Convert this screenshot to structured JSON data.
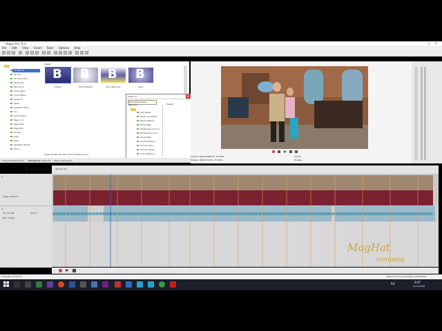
{
  "window": {
    "title": "Vegas Pro 15.0"
  },
  "menu": [
    "File",
    "Edit",
    "View",
    "Insert",
    "Tools",
    "Options",
    "Help"
  ],
  "explorer": {
    "items": [
      "3D Effects",
      "3D Flip",
      "3D Fly In/Out",
      "3D Blinds",
      "Barn Door",
      "Clock Wipe",
      "Cross Effect",
      "Dissolve",
      "Flash",
      "Gradient Wipe",
      "Iris",
      "Linear Wipe",
      "Page Curl",
      "Page Peel",
      "Page Roll",
      "Portals",
      "Push",
      "Split",
      "Venetian Blinds",
      "Zoom"
    ]
  },
  "presets": {
    "header": "Preset:",
    "thumbs": [
      {
        "label": "Simple"
      },
      {
        "label": "Soft Spotlight"
      },
      {
        "label": "Burn Rainbow"
      },
      {
        "label": "Spot"
      }
    ],
    "status": "Vegas 3D Blinds: OFX, 32-bit floating point"
  },
  "tabs": [
    "Project Media",
    "Explorer",
    "Transitions",
    "Video FX",
    "Media Generators"
  ],
  "dialog": {
    "title": "Video FX",
    "search_placeholder": "Hold Ctrl to block selection",
    "preset_header": "Preset:",
    "items": [
      "Add Noise",
      "Black and White",
      "Black Restore",
      "Bump Map",
      "Brightness and Co...",
      "Broadcast Colors",
      "Bump Map",
      "Channel Blend",
      "Chroma Blur",
      "Chroma Keyer",
      "Color Balance"
    ]
  },
  "preview": {
    "project": "Project: 1920x1080x32, 25.000i",
    "preview_label": "Preview: 480x270x32, 25.000p",
    "frame": "Frame:",
    "display": "Display:"
  },
  "timeline": {
    "time": "00:36:14;13",
    "clip_label": "slisdvas 03",
    "tracks": [
      {
        "num": "1",
        "level": "Level: 100.0 %"
      },
      {
        "num": "2",
        "vol": "Vol: 0.0 dB",
        "pan": "Pan: Center",
        "touch": "Touch"
      }
    ],
    "rate": "Rate: 0.00"
  },
  "status": {
    "left": "Complete: 00:00:13",
    "right": "Record Time (2 channels): 0:00:00:00"
  },
  "logo": {
    "line1": "MagHat",
    "line2": "company"
  },
  "taskbar": {
    "lang": "RU",
    "time": "0:07",
    "date": "25.12.2018"
  }
}
